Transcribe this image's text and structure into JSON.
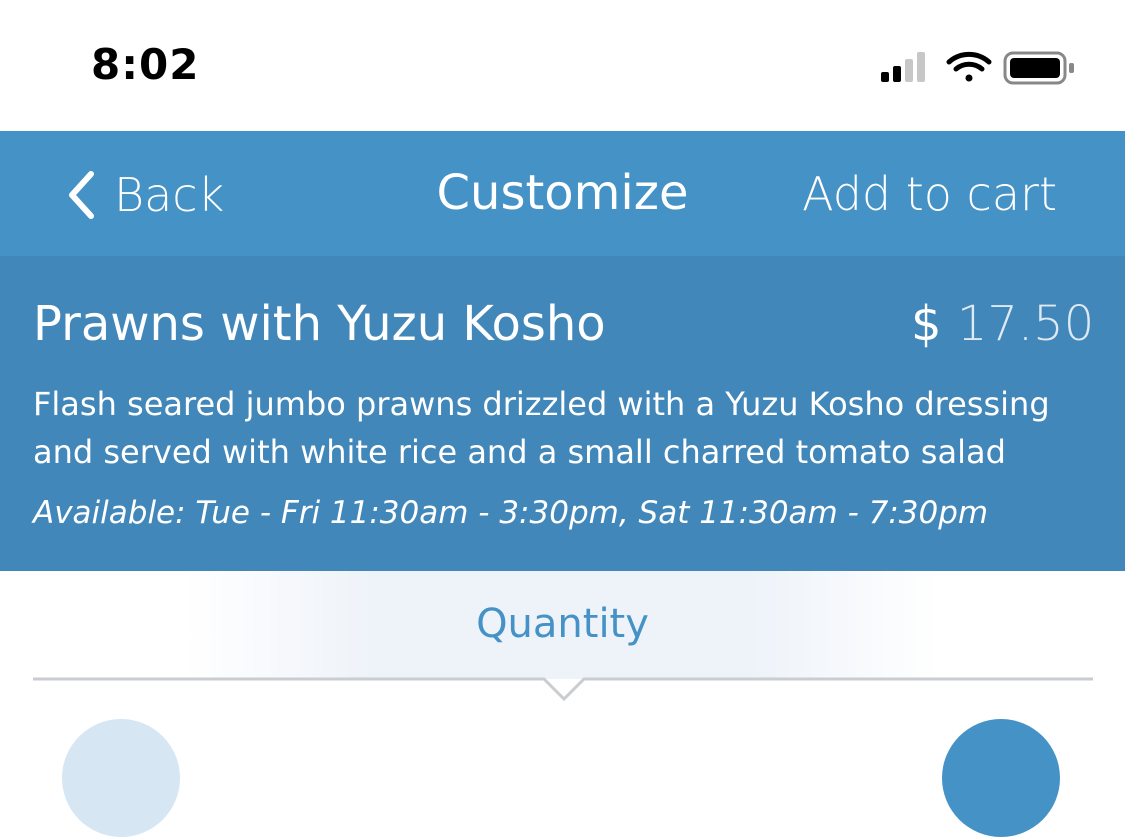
{
  "status": {
    "time": "8:02",
    "icons": [
      "cellular-signal-icon",
      "wifi-icon",
      "battery-icon"
    ]
  },
  "nav": {
    "back_label": "Back",
    "title": "Customize",
    "action_label": "Add to cart"
  },
  "item": {
    "name": "Prawns with Yuzu Kosho",
    "price_currency": "$",
    "price_amount": "17.50",
    "description": "Flash seared jumbo prawns drizzled with a Yuzu Kosho dressing and served with white rice and a small charred tomato salad",
    "availability": "Available: Tue - Fri 11:30am - 3:30pm, Sat 11:30am - 7:30pm"
  },
  "quantity": {
    "title": "Quantity"
  },
  "colors": {
    "nav_bg": "#4592c6",
    "panel_bg": "#4287b9",
    "accent": "#4592c6"
  }
}
